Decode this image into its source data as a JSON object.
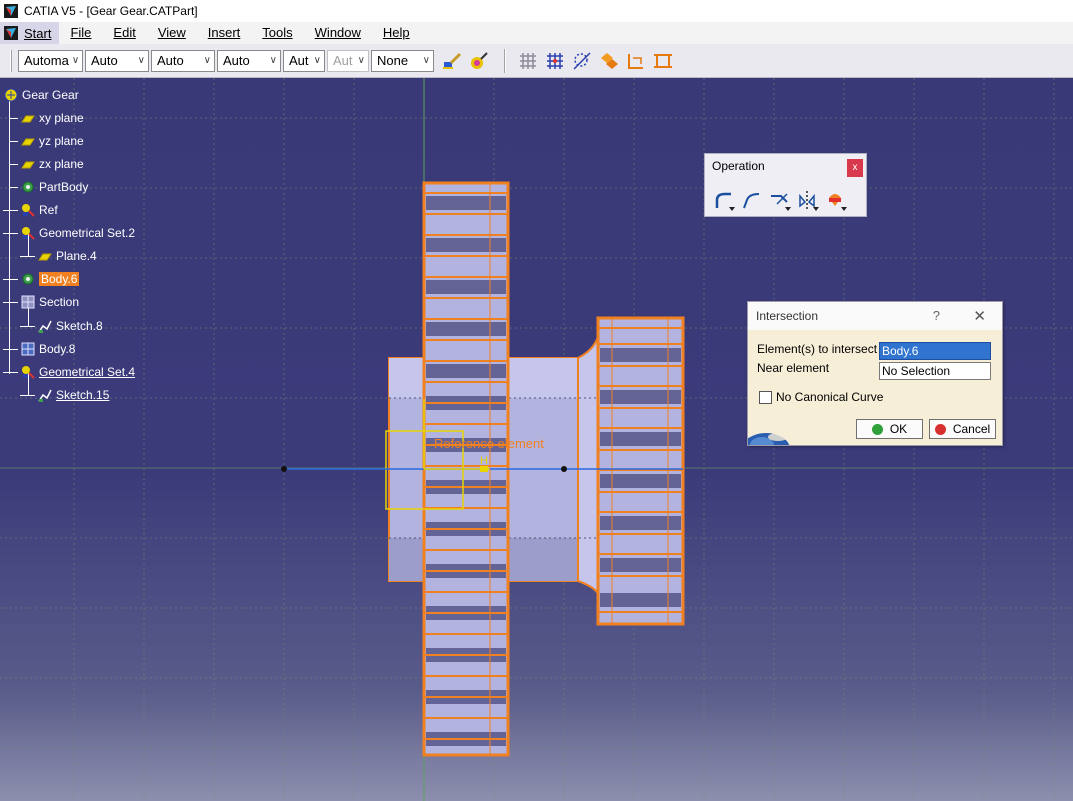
{
  "window": {
    "title": "CATIA V5 - [Gear Gear.CATPart]"
  },
  "menu": {
    "start": "Start",
    "items": [
      "File",
      "Edit",
      "View",
      "Insert",
      "Tools",
      "Window",
      "Help"
    ]
  },
  "toolbar": {
    "combos": [
      "Automa",
      "Auto",
      "Auto",
      "Auto",
      "Aut",
      "Aut",
      "None"
    ]
  },
  "tree": {
    "root": "Gear Gear",
    "nodes": [
      "xy plane",
      "yz plane",
      "zx plane",
      "PartBody",
      "Ref",
      "Geometrical Set.2",
      "Plane.4",
      "Body.6",
      "Section",
      "Sketch.8",
      "Body.8",
      "Geometrical Set.4",
      "Sketch.15"
    ]
  },
  "viewport": {
    "annotation": "Reference element",
    "axis_label": "H"
  },
  "operation_toolbar": {
    "title": "Operation",
    "close": "x"
  },
  "intersection_dialog": {
    "title": "Intersection",
    "help": "?",
    "close": "✕",
    "elements_label": "Element(s) to intersect",
    "elements_value": "Body.6",
    "near_label": "Near element",
    "near_value": "No Selection",
    "no_canonical_label": "No Canonical Curve",
    "no_canonical_checked": false,
    "ok_label": "OK",
    "cancel_label": "Cancel"
  },
  "colors": {
    "viewport_bg": "#3b3a78",
    "selection_orange": "#f08020",
    "part_body": "#b3b3e0"
  }
}
